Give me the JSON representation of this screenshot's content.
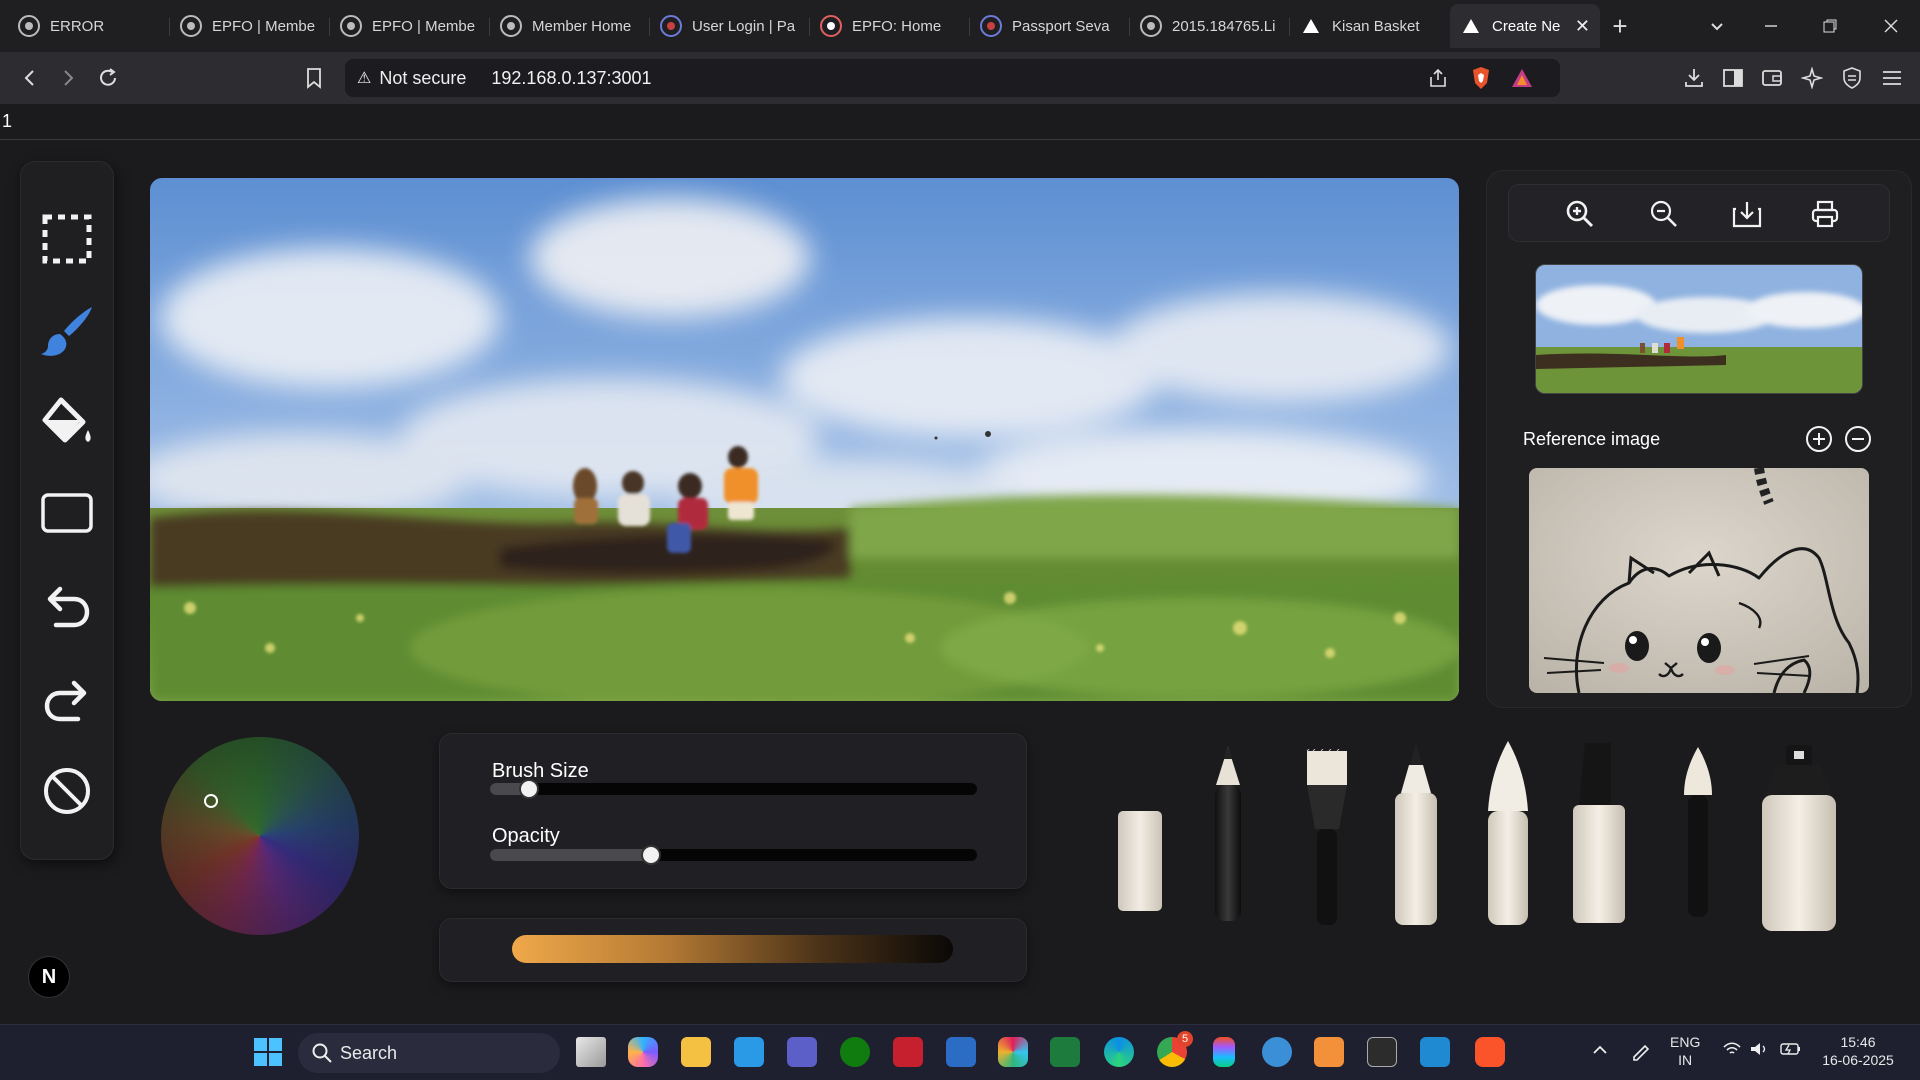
{
  "browser": {
    "tabs": [
      {
        "label": "ERROR",
        "icon": "globe-icon"
      },
      {
        "label": "EPFO | Membe",
        "icon": "globe-icon"
      },
      {
        "label": "EPFO | Membe",
        "icon": "globe-icon"
      },
      {
        "label": "Member Home",
        "icon": "globe-icon"
      },
      {
        "label": "User Login | Pa",
        "icon": "emblem-icon"
      },
      {
        "label": "EPFO: Home",
        "icon": "epfo-icon"
      },
      {
        "label": "Passport Seva",
        "icon": "emblem-icon"
      },
      {
        "label": "2015.184765.Li",
        "icon": "globe-icon"
      },
      {
        "label": "Kisan Basket",
        "icon": "triangle-icon"
      },
      {
        "label": "Create Ne",
        "icon": "triangle-icon",
        "active": true
      }
    ],
    "security_label": "Not secure",
    "url": "192.168.0.137:3001"
  },
  "page": {
    "top_text": "1"
  },
  "app": {
    "tools": [
      "selection-tool",
      "brush-tool",
      "fill-tool",
      "rectangle-tool",
      "undo",
      "redo",
      "clear"
    ],
    "reference_title": "Reference image",
    "brush_size_label": "Brush Size",
    "brush_size_value": 0.08,
    "opacity_label": "Opacity",
    "opacity_value": 0.33,
    "gradient_colors": [
      "#f0a84a",
      "#0a0806"
    ],
    "avatar_letter": "N",
    "brushes": [
      "eraser",
      "pencil",
      "flat-brush",
      "marker",
      "round-brush",
      "chisel-marker",
      "fine-brush",
      "spray-can"
    ]
  },
  "taskbar": {
    "search_label": "Search",
    "lang_top": "ENG",
    "lang_bottom": "IN",
    "time": "15:46",
    "date": "16-06-2025",
    "chrome_badge": "5"
  }
}
